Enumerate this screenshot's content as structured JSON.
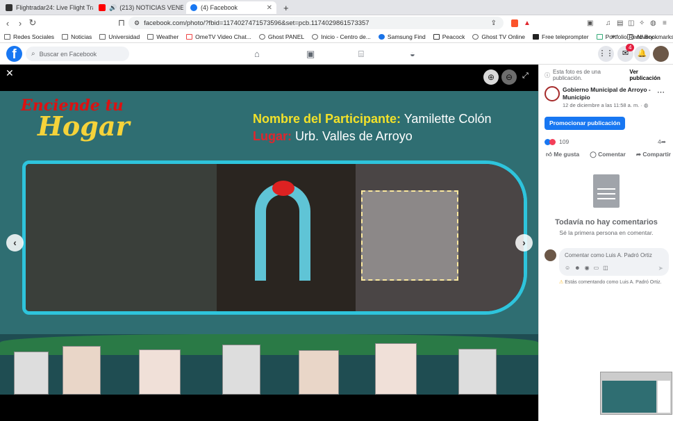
{
  "tabs": [
    {
      "label": "Flightradar24: Live Flight Tracker -",
      "active": false
    },
    {
      "label": "(213)  NOTICIAS VENEZUEL",
      "active": false
    },
    {
      "label": "(4) Facebook",
      "active": true
    }
  ],
  "browser": {
    "url": "facebook.com/photo/?fbid=1174027471573596&set=pcb.1174029861573357"
  },
  "bookmarks": [
    "Redes Sociales",
    "Noticias",
    "Universidad",
    "Weather",
    "OmeTV Video Chat...",
    "Ghost PANEL",
    "Inicio - Centro de...",
    "Samsung Find",
    "Peacock",
    "Ghost TV Online",
    "Free teleprompter",
    "Portfolio Recovery...",
    "All Bookmarks"
  ],
  "fb": {
    "search_placeholder": "Buscar en Facebook",
    "messenger_badge": "4"
  },
  "photo": {
    "logo_line1": "Enciende tu",
    "logo_line2": "Hogar",
    "participant_label": "Nombre del Participante:",
    "participant_value": "Yamilette Colón",
    "place_label": "Lugar:",
    "place_value": "Urb. Valles de Arroyo"
  },
  "panel": {
    "notice": "Esta foto es de una publicación.",
    "view_post": "Ver publicación",
    "page_name": "Gobierno Municipal de Arroyo - Municipio",
    "date": "12 de diciembre a las 11:58 a. m. ·",
    "promote": "Promocionar publicación",
    "reactions_count": "109",
    "shares_count": "4",
    "like": "Me gusta",
    "comment": "Comentar",
    "share": "Compartir",
    "no_comments_title": "Todavía no hay comentarios",
    "no_comments_sub": "Sé la primera persona en comentar.",
    "comment_placeholder": "Comentar como Luis A. Padró Ortiz",
    "commenting_as": "Estás comentando como Luis A. Padró Ortiz."
  },
  "colors": {
    "fb_blue": "#1877f2",
    "teal": "#2f6e72",
    "cyan_border": "#2ec4dc",
    "yellow": "#f2e12a",
    "red": "#e0262d"
  }
}
